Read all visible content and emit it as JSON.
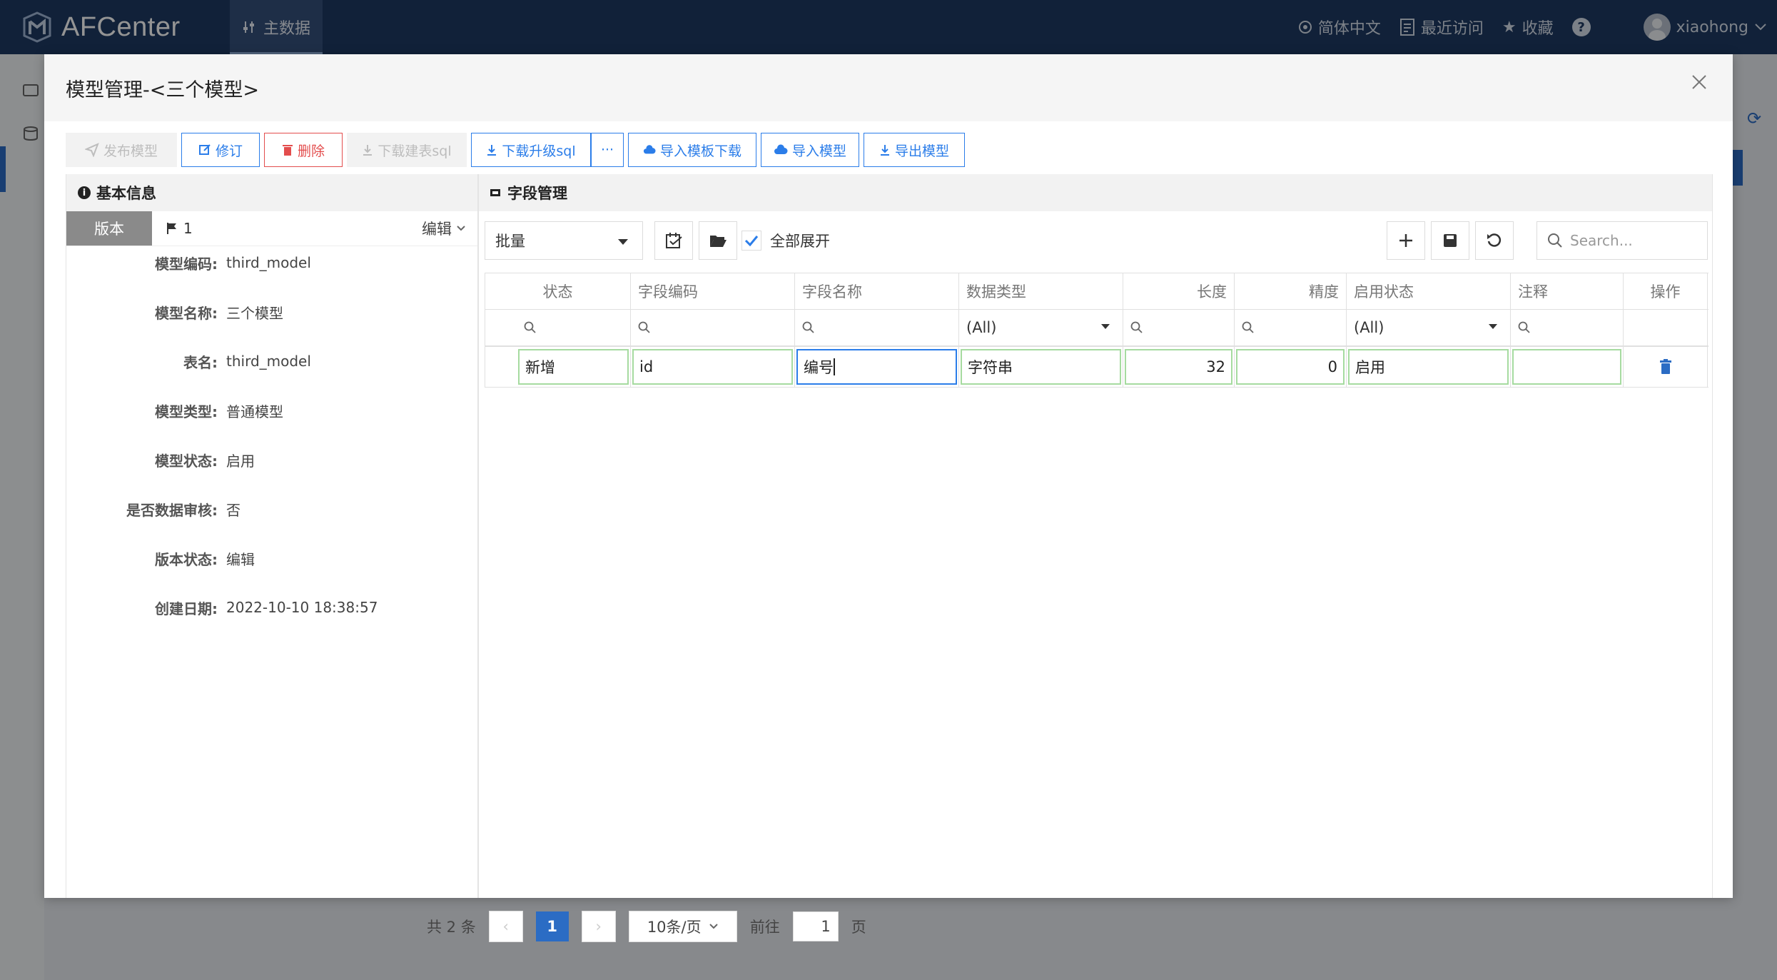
{
  "app": {
    "brand": "AFCenter",
    "nav_item": "主数据",
    "language": "简体中文",
    "recent": "最近访问",
    "favorites": "收藏",
    "help": "?",
    "username": "xiaohong"
  },
  "background_pager": {
    "total": "共 2 条",
    "current_page": "1",
    "page_size": "10条/页",
    "goto_label": "前往",
    "goto_value": "1",
    "page_suffix": "页"
  },
  "dialog": {
    "title": "模型管理-<三个模型>",
    "toolbar": {
      "publish": "发布模型",
      "revise": "修订",
      "delete": "删除",
      "download_create_sql": "下载建表sql",
      "download_upgrade_sql": "下载升级sql",
      "more": "···",
      "template_download": "导入模板下载",
      "import_model": "导入模型",
      "export_model": "导出模型"
    },
    "basic_info": {
      "header": "基本信息",
      "version_tab": "版本",
      "version_number": "1",
      "edit_label": "编辑",
      "fields": [
        {
          "label": "模型编码:",
          "value": "third_model"
        },
        {
          "label": "模型名称:",
          "value": "三个模型"
        },
        {
          "label": "表名:",
          "value": "third_model"
        },
        {
          "label": "模型类型:",
          "value": "普通模型"
        },
        {
          "label": "模型状态:",
          "value": "启用"
        },
        {
          "label": "是否数据审核:",
          "value": "否"
        },
        {
          "label": "版本状态:",
          "value": "编辑"
        },
        {
          "label": "创建日期:",
          "value": "2022-10-10 18:38:57"
        }
      ]
    },
    "field_mgmt": {
      "header": "字段管理",
      "batch_select": "批量",
      "expand_all": "全部展开",
      "expand_all_checked": true,
      "search_placeholder": "Search...",
      "columns": [
        "状态",
        "字段编码",
        "字段名称",
        "数据类型",
        "长度",
        "精度",
        "启用状态",
        "注释",
        "操作"
      ],
      "filter_all": "(All)",
      "rows": [
        {
          "status": "新增",
          "code": "id",
          "name": "编号",
          "type": "字符串",
          "length": "32",
          "precision": "0",
          "enabled": "启用",
          "comment": ""
        }
      ]
    }
  },
  "colors": {
    "header_bg": "#1e3a63",
    "primary": "#2b7de9",
    "danger": "#e34d4d",
    "edited_cell_border": "#a6dba0"
  }
}
